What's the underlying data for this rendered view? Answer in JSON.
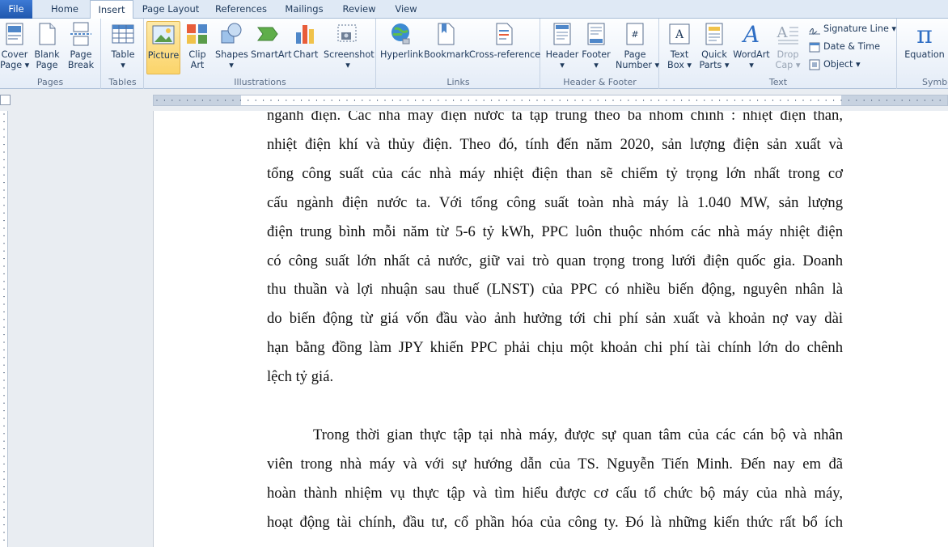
{
  "tabs": [
    {
      "label": "File"
    },
    {
      "label": "Home"
    },
    {
      "label": "Insert"
    },
    {
      "label": "Page Layout"
    },
    {
      "label": "References"
    },
    {
      "label": "Mailings"
    },
    {
      "label": "Review"
    },
    {
      "label": "View"
    }
  ],
  "ribbon": {
    "pages": {
      "label": "Pages",
      "cover": "Cover",
      "cover2": "Page",
      "blank": "Blank",
      "blank2": "Page",
      "break": "Page",
      "break2": "Break"
    },
    "tables": {
      "label": "Tables",
      "table": "Table"
    },
    "illustrations": {
      "label": "Illustrations",
      "picture": "Picture",
      "clip": "Clip",
      "clip2": "Art",
      "shapes": "Shapes",
      "smartart": "SmartArt",
      "chart": "Chart",
      "screenshot": "Screenshot"
    },
    "links": {
      "label": "Links",
      "hyperlink": "Hyperlink",
      "bookmark": "Bookmark",
      "crossref": "Cross-reference"
    },
    "header_footer": {
      "label": "Header & Footer",
      "header": "Header",
      "footer": "Footer",
      "pagenum": "Page",
      "pagenum2": "Number"
    },
    "text": {
      "label": "Text",
      "textbox": "Text",
      "textbox2": "Box",
      "quickparts": "Quick",
      "quickparts2": "Parts",
      "wordart": "WordArt",
      "dropcap": "Drop",
      "dropcap2": "Cap",
      "signature": "Signature Line",
      "datetime": "Date & Time",
      "object": "Object"
    },
    "symbols": {
      "label": "Symbo",
      "equation": "Equation"
    }
  },
  "document": {
    "lines1": [
      "ngành điện. Các nhà máy điện nước ta tập trung theo ba nhóm chính : nhiệt điện than,",
      "nhiệt điện khí và thủy điện. Theo đó, tính đến năm 2020, sản lượng điện sản xuất và",
      "tổng công suất của các nhà máy nhiệt điện than sẽ chiếm tỷ trọng lớn nhất trong cơ",
      "cấu ngành điện nước ta. Với tổng công suất toàn nhà máy là 1.040 MW, sản lượng",
      "điện trung bình mỗi năm từ 5-6 tỷ kWh, PPC luôn thuộc nhóm các nhà máy nhiệt điện",
      "có công suất lớn nhất cả nước, giữ vai trò quan trọng trong lưới điện quốc gia. Doanh",
      "thu thuần và lợi nhuận sau thuế (LNST) của PPC có nhiều biến động, nguyên nhân là",
      "do biến động từ giá vốn đầu vào ảnh hưởng tới chi phí sản xuất và khoản nợ vay dài",
      "hạn bằng đồng làm JPY khiến PPC phải chịu một khoản chi phí tài chính lớn do chênh",
      "lệch tỷ giá."
    ],
    "lines2": [
      "Trong thời gian thực tập tại nhà máy, được sự quan tâm của các cán bộ và nhân",
      "viên trong nhà máy và với sự hướng dẫn của TS. Nguyễn Tiến Minh. Đến nay em đã",
      "hoàn thành nhiệm vụ thực tập và tìm hiểu được cơ cấu tổ chức bộ máy của nhà máy,",
      "hoạt động tài chính, đầu tư, cổ phần hóa của công ty. Đó là những kiến thức rất bổ ích"
    ]
  }
}
